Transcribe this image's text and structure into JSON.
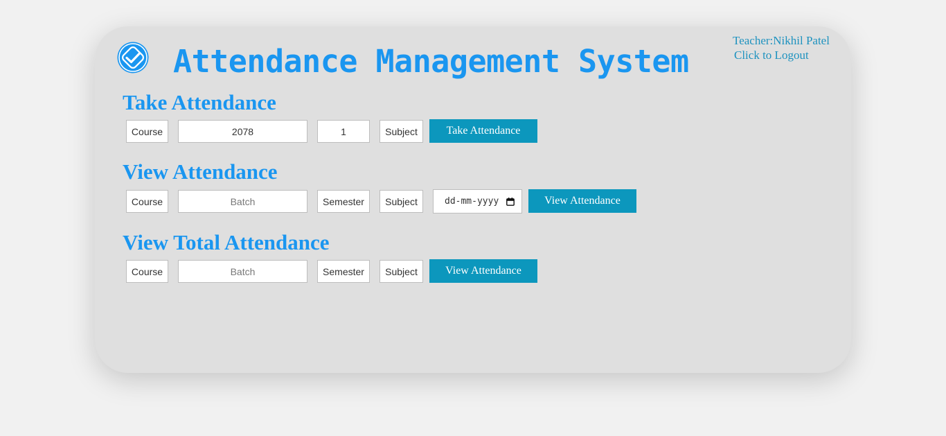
{
  "header": {
    "title": "Attendance Management System",
    "teacher_label": "Teacher:",
    "teacher_name": "Nikhil Patel",
    "logout_label": "Click to Logout",
    "logo_icon": "checkmark-badge-icon"
  },
  "take": {
    "heading": "Take Attendance",
    "course": "Course",
    "batch": "2078",
    "semester": "1",
    "subject": "Subject",
    "button": "Take Attendance"
  },
  "view": {
    "heading": "View Attendance",
    "course": "Course",
    "batch_placeholder": "Batch",
    "semester": "Semester",
    "subject": "Subject",
    "date_placeholder": "dd-mm-yyyy",
    "button": "View Attendance"
  },
  "total": {
    "heading": "View Total Attendance",
    "course": "Course",
    "batch_placeholder": "Batch",
    "semester": "Semester",
    "subject": "Subject",
    "button": "View Attendance"
  },
  "colors": {
    "accent": "#1a96f0",
    "button": "#0c97bd",
    "card": "#dfdfdf",
    "background": "#f1f1f1"
  }
}
